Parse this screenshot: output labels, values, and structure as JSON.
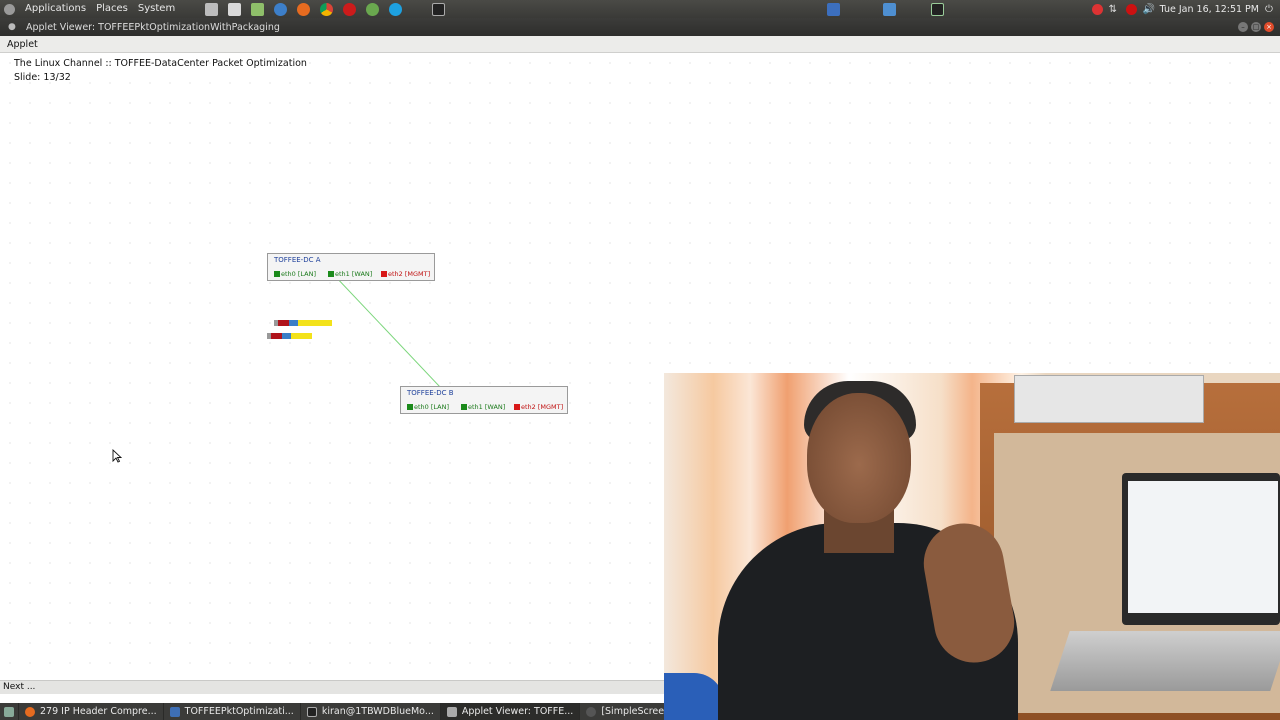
{
  "panel": {
    "menus": [
      "Applications",
      "Places",
      "System"
    ],
    "clock": "Tue Jan 16, 12:51 PM"
  },
  "window": {
    "title": "Applet Viewer: TOFFEEPktOptimizationWithPackaging",
    "menu": "Applet"
  },
  "applet": {
    "heading": "The Linux Channel :: TOFFEE-DataCenter Packet Optimization",
    "slide": "Slide: 13/32",
    "nodes": [
      {
        "name": "TOFFEE-DC A",
        "ifaces": [
          "eth0 [LAN]",
          "eth1 [WAN]",
          "eth2 [MGMT]"
        ]
      },
      {
        "name": "TOFFEE-DC B",
        "ifaces": [
          "eth0 [LAN]",
          "eth1 [WAN]",
          "eth2 [MGMT]"
        ]
      }
    ]
  },
  "status": "Next ...",
  "taskbar": [
    {
      "label": "279 IP Header Compre...",
      "icon": "firefox-icon"
    },
    {
      "label": "TOFFEEPktOptimizati...",
      "icon": "java-icon"
    },
    {
      "label": "kiran@1TBWDBlueMo...",
      "icon": "terminal-icon"
    },
    {
      "label": "Applet Viewer: TOFFE...",
      "icon": "applet-icon"
    },
    {
      "label": "[SimpleScreenRecorder]",
      "icon": "recorder-icon"
    }
  ],
  "colors": {
    "lan": "#1b7a1b",
    "wan": "#1b7a1b",
    "mgmt": "#c01010",
    "link": "#7cd67c"
  }
}
